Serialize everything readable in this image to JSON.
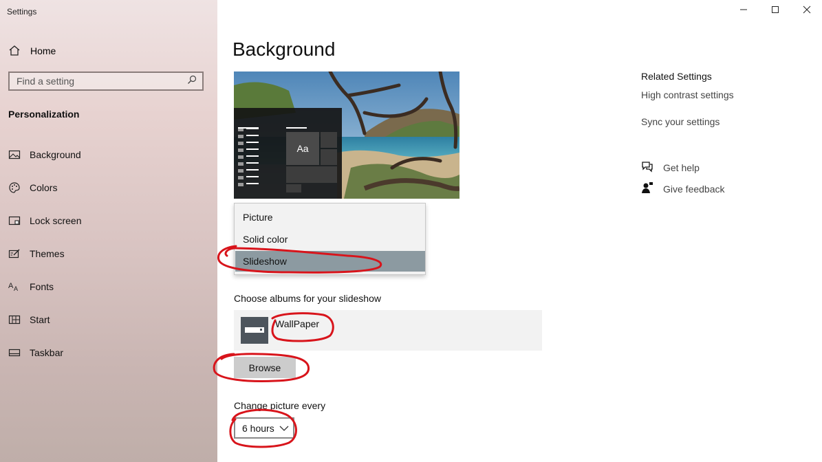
{
  "window": {
    "title": "Settings",
    "controls": [
      "minimize-icon",
      "maximize-icon",
      "close-icon"
    ]
  },
  "sidebar": {
    "home": {
      "label": "Home",
      "icon": "home-icon"
    },
    "search": {
      "placeholder": "Find a setting",
      "icon": "search-icon"
    },
    "section": "Personalization",
    "items": [
      {
        "label": "Background",
        "icon": "picture-icon"
      },
      {
        "label": "Colors",
        "icon": "palette-icon"
      },
      {
        "label": "Lock screen",
        "icon": "lock-screen-icon"
      },
      {
        "label": "Themes",
        "icon": "themes-icon"
      },
      {
        "label": "Fonts",
        "icon": "fonts-icon"
      },
      {
        "label": "Start",
        "icon": "start-icon"
      },
      {
        "label": "Taskbar",
        "icon": "taskbar-icon"
      }
    ]
  },
  "main": {
    "title": "Background",
    "preview": {
      "tile_text": "Aa"
    },
    "background_dropdown": {
      "options": [
        "Picture",
        "Solid color",
        "Slideshow"
      ],
      "selected": "Slideshow"
    },
    "albums": {
      "label": "Choose albums for your slideshow",
      "album_name": "WallPaper"
    },
    "browse_label": "Browse",
    "interval": {
      "label": "Change picture every",
      "value": "6 hours"
    }
  },
  "related": {
    "title": "Related Settings",
    "links": [
      "High contrast settings",
      "Sync your settings"
    ],
    "help": {
      "label": "Get help",
      "icon": "help-chat-icon"
    },
    "feedback": {
      "label": "Give feedback",
      "icon": "feedback-icon"
    }
  },
  "colors": {
    "annotation": "#d8141b",
    "dropdown_selected": "#8c9aa1",
    "button": "#cccccc"
  }
}
